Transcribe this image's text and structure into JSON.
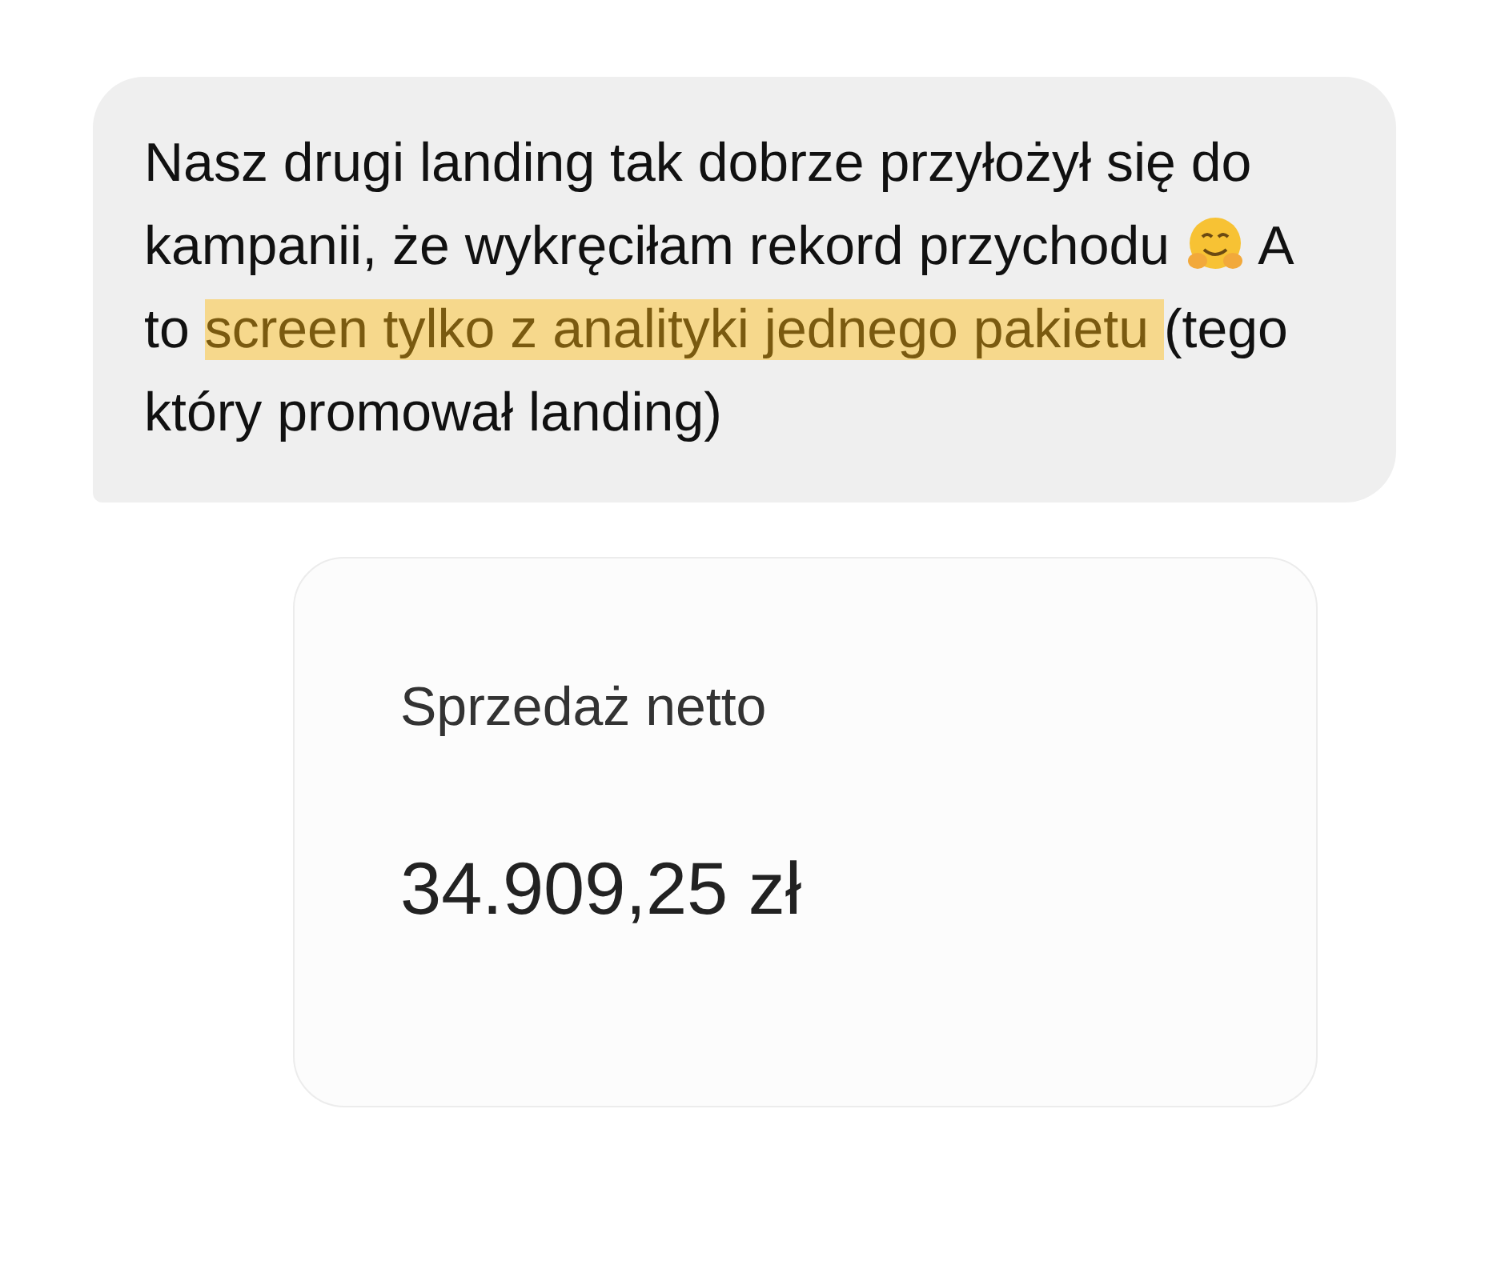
{
  "message": {
    "segments": [
      {
        "kind": "text",
        "text": "Nasz drugi landing tak dobrze przyłożył się do kampanii, że wykręciłam rekord przychodu "
      },
      {
        "kind": "emoji"
      },
      {
        "kind": "text",
        "text": " A to "
      },
      {
        "kind": "highlight",
        "text": "screen tylko z analityki jednego pakietu "
      },
      {
        "kind": "text",
        "text": "(tego który promował landing)"
      }
    ]
  },
  "card": {
    "label": "Sprzedaż netto",
    "value": "34.909,25 zł"
  }
}
